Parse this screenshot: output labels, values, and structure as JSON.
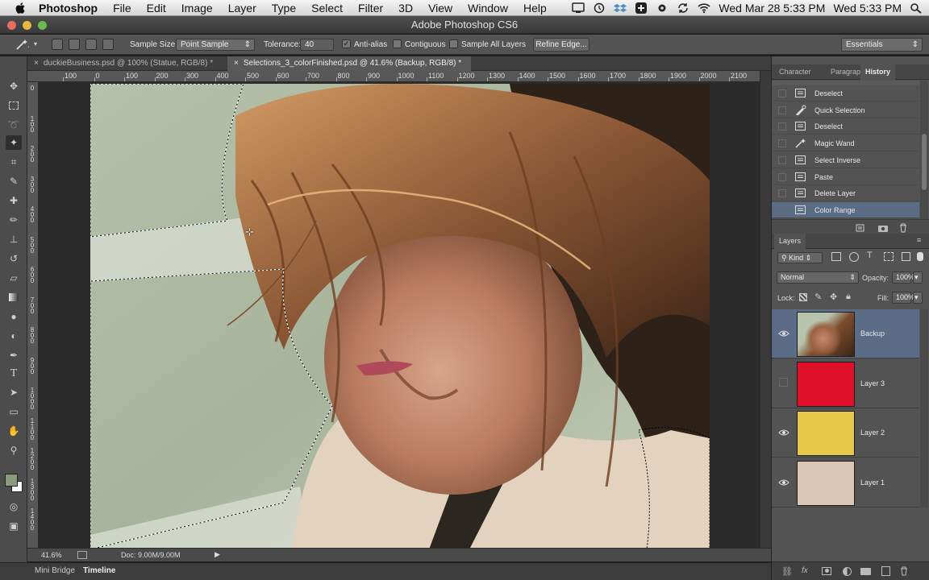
{
  "menubar": {
    "app_name": "Photoshop",
    "items": [
      "File",
      "Edit",
      "Image",
      "Layer",
      "Type",
      "Select",
      "Filter",
      "3D",
      "View",
      "Window",
      "Help"
    ],
    "clock_1": "Wed Mar 28  5:33 PM",
    "clock_2": "Wed 5:33 PM"
  },
  "window": {
    "title": "Adobe Photoshop CS6"
  },
  "options": {
    "sample_size_label": "Sample Size:",
    "sample_size_value": "Point Sample",
    "tolerance_label": "Tolerance:",
    "tolerance_value": "40",
    "antialias_label": "Anti-alias",
    "antialias_checked": "✓",
    "contiguous_label": "Contiguous",
    "sample_all_label": "Sample All Layers",
    "refine_edge_label": "Refine Edge...",
    "workspace": "Essentials"
  },
  "tabs": [
    {
      "label": "duckieBusiness.psd @ 100% (Statue, RGB/8) *",
      "close": "×"
    },
    {
      "label": "Selections_3_colorFinished.psd @ 41.6% (Backup, RGB/8) *",
      "close": "×"
    }
  ],
  "ruler": {
    "h_labels": [
      "100",
      "0",
      "100",
      "200",
      "300",
      "400",
      "500",
      "600",
      "700",
      "800",
      "900",
      "1000",
      "1100",
      "1200",
      "1300",
      "1400",
      "1500",
      "1600",
      "1700",
      "1800",
      "1900",
      "2000",
      "2100",
      "2"
    ],
    "v_labels": [
      "0",
      "1 0 0",
      "2 0 0",
      "3 0 0",
      "4 0 0",
      "5 0 0",
      "6 0 0",
      "7 0 0",
      "8 0 0",
      "9 0 0",
      "1 0 0 0",
      "1 1 0 0",
      "1 2 0 0",
      "1 3 0 0",
      "1 4 0 0"
    ]
  },
  "status": {
    "zoom": "41.6%",
    "doc": "Doc: 9.00M/9.00M"
  },
  "bottom_tabs": [
    "Mini Bridge",
    "Timeline"
  ],
  "history_panel": {
    "tabs": [
      "Character",
      "Paragraph",
      "History"
    ],
    "items": [
      "Deselect",
      "Quick Selection",
      "Deselect",
      "Magic Wand",
      "Select Inverse",
      "Paste",
      "Delete Layer",
      "Color Range"
    ]
  },
  "layers_panel": {
    "title": "Layers",
    "filter": "Kind",
    "blend_mode": "Normal",
    "opacity_label": "Opacity:",
    "opacity_value": "100%",
    "lock_label": "Lock:",
    "fill_label": "Fill:",
    "fill_value": "100%",
    "layers": [
      {
        "name": "Backup",
        "color": "#8a6a55",
        "visible": true
      },
      {
        "name": "Layer 3",
        "color": "#e0102a",
        "visible": false
      },
      {
        "name": "Layer 2",
        "color": "#e8c848",
        "visible": true
      },
      {
        "name": "Layer 1",
        "color": "#dcc7b6",
        "visible": true
      }
    ]
  },
  "colors": {
    "accent_selected": "#5b6c86",
    "foreground": "#8a9a7e",
    "background": "#ffffff"
  }
}
